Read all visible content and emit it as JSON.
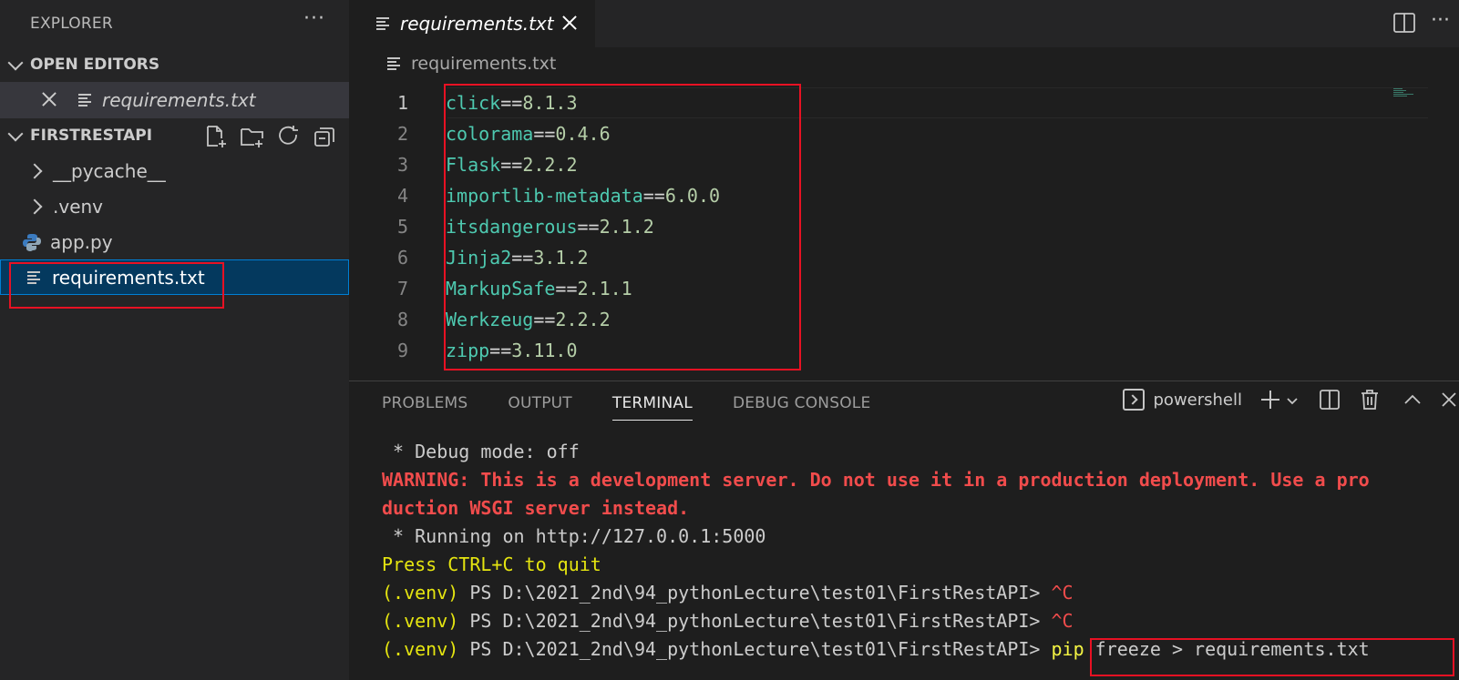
{
  "sidebar": {
    "title": "EXPLORER",
    "more": "···",
    "open_editors_label": "OPEN EDITORS",
    "open_editor_file": "requirements.txt",
    "project_label": "FIRSTRESTAPI",
    "items": [
      {
        "label": "__pycache__"
      },
      {
        "label": ".venv"
      },
      {
        "label": "app.py"
      },
      {
        "label": "requirements.txt"
      }
    ]
  },
  "editor": {
    "tab_label": "requirements.txt",
    "breadcrumb": "requirements.txt",
    "lines": [
      {
        "num": "1",
        "pkg": "click",
        "op": "==",
        "ver": "8.1.3"
      },
      {
        "num": "2",
        "pkg": "colorama",
        "op": "==",
        "ver": "0.4.6"
      },
      {
        "num": "3",
        "pkg": "Flask",
        "op": "==",
        "ver": "2.2.2"
      },
      {
        "num": "4",
        "pkg": "importlib-metadata",
        "op": "==",
        "ver": "6.0.0"
      },
      {
        "num": "5",
        "pkg": "itsdangerous",
        "op": "==",
        "ver": "2.1.2"
      },
      {
        "num": "6",
        "pkg": "Jinja2",
        "op": "==",
        "ver": "3.1.2"
      },
      {
        "num": "7",
        "pkg": "MarkupSafe",
        "op": "==",
        "ver": "2.1.1"
      },
      {
        "num": "8",
        "pkg": "Werkzeug",
        "op": "==",
        "ver": "2.2.2"
      },
      {
        "num": "9",
        "pkg": "zipp",
        "op": "==",
        "ver": "3.11.0"
      }
    ]
  },
  "panel": {
    "tabs": [
      "PROBLEMS",
      "OUTPUT",
      "TERMINAL",
      "DEBUG CONSOLE"
    ],
    "shell": "powershell",
    "terminal": {
      "l1": " * Debug mode: off",
      "l2": "WARNING: This is a development server. Do not use it in a production deployment. Use a pro",
      "l3": "duction WSGI server instead.",
      "l4": " * Running on http://127.0.0.1:5000",
      "l5": "Press CTRL+C to quit",
      "venv": "(.venv)",
      "prompt": " PS D:\\2021_2nd\\94_pythonLecture\\test01\\FirstRestAPI> ",
      "ctrlc": "^C",
      "cmd_pip": "pip",
      "cmd_rest": " freeze > requirements.txt"
    }
  }
}
